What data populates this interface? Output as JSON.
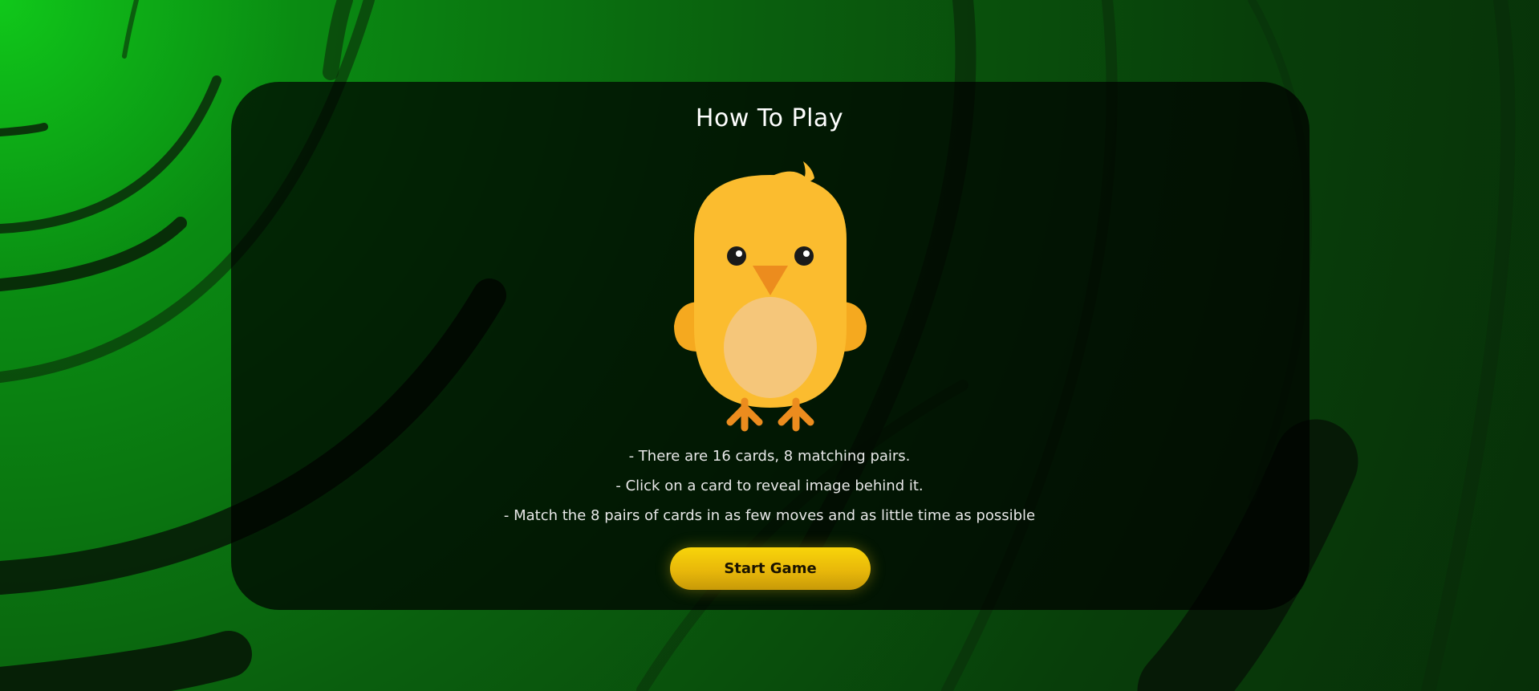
{
  "colors": {
    "background_top_left": "#10c81a",
    "background_deep": "#072f08",
    "panel": "#000000",
    "button": "#f0c80a",
    "chick_body": "#fbbc2f",
    "chick_belly": "#f5c67a",
    "chick_beak": "#ec8c1e",
    "chick_feet": "#ec8c1e"
  },
  "panel": {
    "title": "How To Play",
    "mascot_icon": "chick-icon"
  },
  "instructions": [
    "- There are 16 cards, 8 matching pairs.",
    "- Click on a card to reveal image behind it.",
    "- Match the 8 pairs of cards in as few moves and as little time as possible"
  ],
  "start_button": {
    "label": "Start Game"
  }
}
